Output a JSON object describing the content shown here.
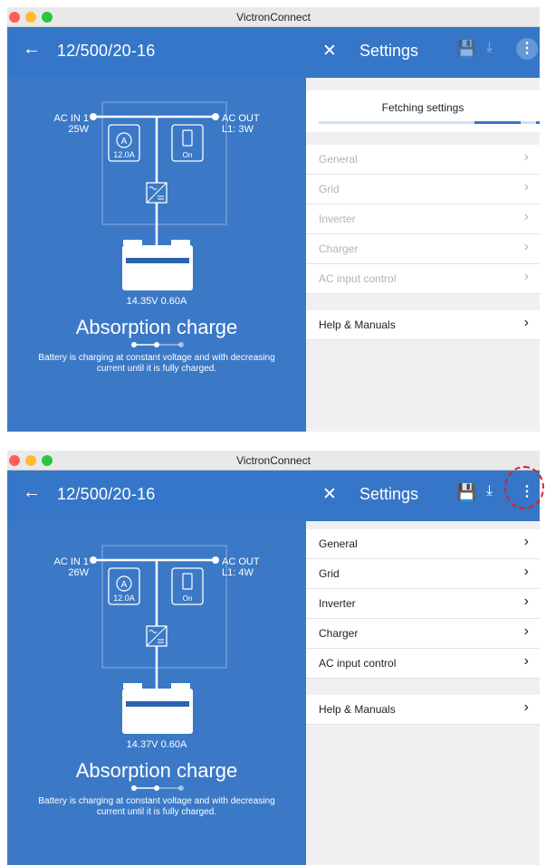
{
  "app_title": "VictronConnect",
  "device_name": "12/500/20-16",
  "settings_title": "Settings",
  "fetching_text": "Fetching settings",
  "menu": [
    "General",
    "Grid",
    "Inverter",
    "Charger",
    "AC input control"
  ],
  "help_label": "Help & Manuals",
  "status_title": "Absorption charge",
  "status_desc_line1": "Battery is charging at constant voltage and with decreasing",
  "status_desc_line2": "current until it is fully charged.",
  "labels": {
    "ac_in": "AC IN 1",
    "ac_out": "AC OUT",
    "current_limit": "12.0A",
    "switch_state": "On"
  },
  "panel1": {
    "ac_in_power": "25W",
    "ac_out_power": "L1: 3W",
    "battery_reading": "14.35V  0.60A",
    "settings_loaded": false
  },
  "panel2": {
    "ac_in_power": "26W",
    "ac_out_power": "L1: 4W",
    "battery_reading": "14.37V  0.60A",
    "settings_loaded": true
  },
  "colors": {
    "header": "#3576c8",
    "panel": "#3b79c7",
    "highlight": "#e02020"
  }
}
